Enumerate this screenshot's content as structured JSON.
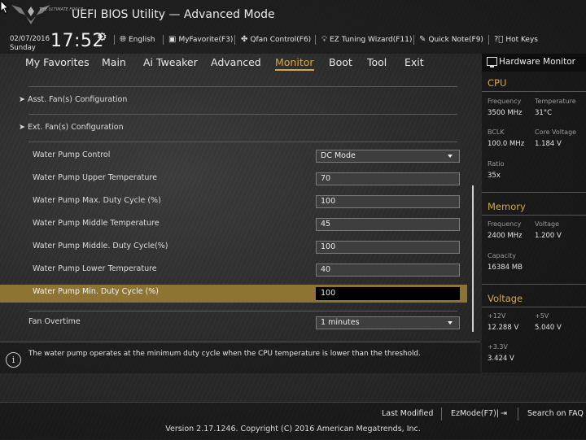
{
  "header": {
    "title": "UEFI BIOS Utility — Advanced Mode",
    "logo_text": "THE ULTIMATE FORCE",
    "date": "02/07/2016",
    "day": "Sunday",
    "time": "17:52",
    "toolbar": [
      {
        "icon": "globe-icon",
        "label": "English"
      },
      {
        "icon": "favorite-icon",
        "label": "MyFavorite(F3)"
      },
      {
        "icon": "fan-icon",
        "label": "Qfan Control(F6)"
      },
      {
        "icon": "bulb-icon",
        "label": "EZ Tuning Wizard(F11)"
      },
      {
        "icon": "note-icon",
        "label": "Quick Note(F9)"
      },
      {
        "icon": "help-icon",
        "label": "Hot Keys"
      }
    ]
  },
  "menu": [
    "My Favorites",
    "Main",
    "Ai Tweaker",
    "Advanced",
    "Monitor",
    "Boot",
    "Tool",
    "Exit"
  ],
  "menu_active": "Monitor",
  "content": {
    "submenus": [
      "Asst. Fan(s) Configuration",
      "Ext. Fan(s) Configuration"
    ],
    "settings": [
      {
        "label": "Water Pump Control",
        "value": "DC Mode"
      },
      {
        "label": "Water Pump Upper Temperature",
        "value": "70"
      },
      {
        "label": "Water Pump Max. Duty Cycle (%)",
        "value": "100"
      },
      {
        "label": "Water Pump Middle Temperature",
        "value": "45"
      },
      {
        "label": "Water Pump Middle. Duty Cycle(%)",
        "value": "100"
      },
      {
        "label": "Water Pump Lower Temperature",
        "value": "40"
      },
      {
        "label": "Water Pump Min. Duty Cycle (%)",
        "value": "100"
      },
      {
        "label": "Fan Overtime",
        "value": "1 minutes"
      }
    ]
  },
  "help_text": "The water pump operates at the minimum duty cycle when the CPU temperature is lower than the threshold.",
  "hardware_monitor": {
    "title": "Hardware Monitor",
    "cpu": {
      "heading": "CPU",
      "frequency_label": "Frequency",
      "frequency": "3500 MHz",
      "temperature_label": "Temperature",
      "temperature": "31°C",
      "bclk_label": "BCLK",
      "bclk": "100.0 MHz",
      "core_voltage_label": "Core Voltage",
      "core_voltage": "1.184 V",
      "ratio_label": "Ratio",
      "ratio": "35x"
    },
    "memory": {
      "heading": "Memory",
      "frequency_label": "Frequency",
      "frequency": "2400 MHz",
      "voltage_label": "Voltage",
      "voltage": "1.200 V",
      "capacity_label": "Capacity",
      "capacity": "16384 MB"
    },
    "voltage": {
      "heading": "Voltage",
      "v12_label": "+12V",
      "v12": "12.288 V",
      "v5_label": "+5V",
      "v5": "5.040 V",
      "v33_label": "+3.3V",
      "v33": "3.424 V"
    }
  },
  "footer": {
    "last_modified": "Last Modified",
    "ezmode": "EzMode(F7)|",
    "search": "Search on FAQ",
    "version": "Version 2.17.1246. Copyright (C) 2016 American Megatrends, Inc."
  },
  "colors": {
    "accent": "#d4a84a",
    "highlight": "#8d7433"
  }
}
